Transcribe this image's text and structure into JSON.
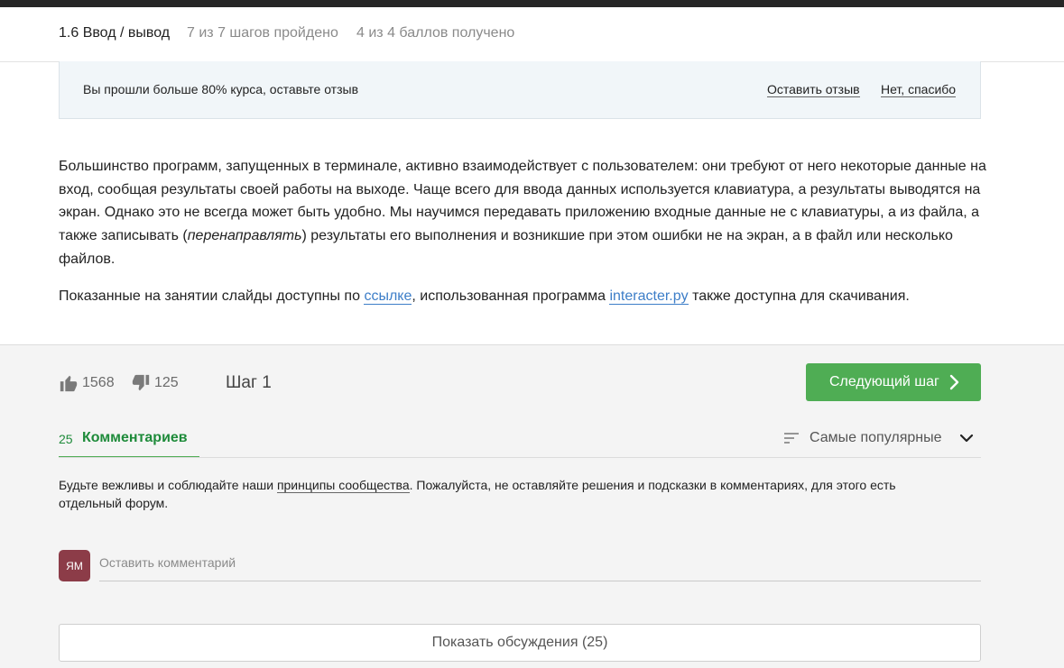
{
  "lesson": {
    "title": "1.6 Ввод / вывод",
    "steps": "7 из 7 шагов пройдено",
    "points": "4 из 4 баллов  получено"
  },
  "review_banner": {
    "text": "Вы прошли больше 80% курса, оставьте отзыв",
    "leave_label": "Оставить отзыв",
    "decline_label": "Нет, спасибо"
  },
  "content": {
    "p1": "Большинство программ, запущенных в терминале, активно взаимодействует с пользователем: они требуют от него некоторые данные на вход, сообщая результаты своей работы на выходе. Чаще всего для ввода данных используется клавиатура, а результаты выводятся на экран. Однако это не всегда может быть удобно. Мы научимся передавать приложению входные данные не с клавиатуры, а из файла, а также записывать (",
    "p1_em": "перенаправлять",
    "p1_end": ") результаты его выполнения и возникшие при этом ошибки не на экран, а в файл или несколько файлов.",
    "p2_start": "Показанные на занятии слайды доступны по ",
    "p2_link1": "ссылке",
    "p2_mid": ", использованная программа ",
    "p2_link2": "interacter.py",
    "p2_end": " также доступна для скачивания."
  },
  "footer": {
    "likes": "1568",
    "dislikes": "125",
    "step_label": "Шаг 1",
    "next_label": "Следующий шаг"
  },
  "comments": {
    "count": "25",
    "label": "Комментариев",
    "sort_label": "Самые популярные",
    "rules_start": "Будьте вежливы и соблюдайте наши ",
    "rules_link": "принципы сообщества",
    "rules_end": ". Пожалуйста, не оставляйте решения и подсказки в комментариях, для этого есть отдельный форум.",
    "avatar_initials": "ЯМ",
    "input_placeholder": "Оставить комментарий",
    "show_discussions": "Показать обсуждения (25)"
  },
  "colors": {
    "accent_green": "#4fad54",
    "tab_green": "#1e8b3a",
    "link_blue": "#3d7ec8",
    "avatar_bg": "#8c3c48",
    "banner_bg": "#f1f6f9"
  },
  "icons": {
    "like": "thumbs-up-icon",
    "dislike": "thumbs-down-icon",
    "next": "chevron-right-icon",
    "sort": "sort-lines-icon",
    "dropdown": "chevron-down-icon"
  }
}
